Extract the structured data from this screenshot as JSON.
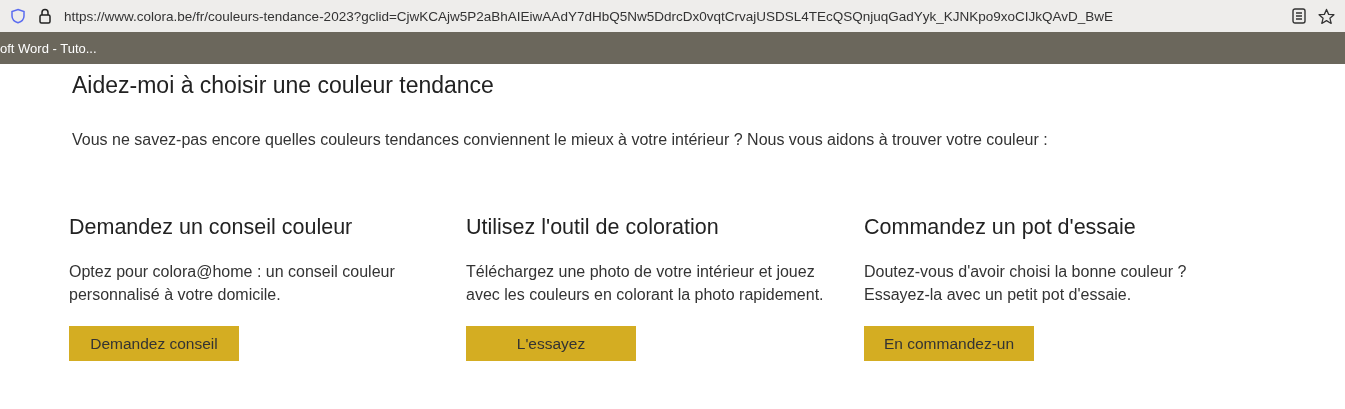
{
  "browser": {
    "url": "https://www.colora.be/fr/couleurs-tendance-2023?gclid=CjwKCAjw5P2aBhAIEiwAAdY7dHbQ5Nw5DdrcDx0vqtCrvajUSDSL4TEcQSQnjuqGadYyk_KJNKpo9xoCIJkQAvD_BwE",
    "bookmark": "oft Word - Tuto..."
  },
  "page": {
    "title": "Aidez-moi à choisir une couleur tendance",
    "intro": "Vous ne savez-pas encore quelles couleurs tendances conviennent le mieux à votre intérieur ? Nous vous aidons à trouver votre couleur :",
    "options": [
      {
        "heading": "Demandez un conseil couleur",
        "text": "Optez pour colora@home : un conseil couleur personnalisé à votre domicile.",
        "button": "Demandez conseil"
      },
      {
        "heading": "Utilisez l'outil de coloration",
        "text": "Téléchargez une photo de votre intérieur et jouez avec les couleurs en colorant la photo rapidement.",
        "button": "L'essayez"
      },
      {
        "heading": "Commandez un pot d'essaie",
        "text": "Doutez-vous d'avoir choisi la bonne couleur ? Essayez-la avec un petit pot d'essaie.",
        "button": "En commandez-un"
      }
    ]
  }
}
